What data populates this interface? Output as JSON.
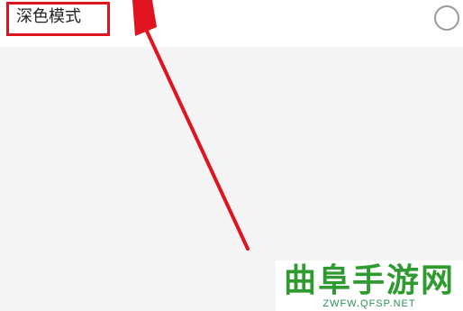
{
  "settings": {
    "dark_mode": {
      "label": "深色模式",
      "selected": false
    }
  },
  "annotation": {
    "highlight_color": "#e0141e",
    "arrow_color": "#e0141e",
    "arrow_icon": "arrow-up-icon"
  },
  "watermark": {
    "title": "曲阜手游网",
    "url": "ZWFW.QFSP.NET",
    "color": "#2f9a2f"
  }
}
